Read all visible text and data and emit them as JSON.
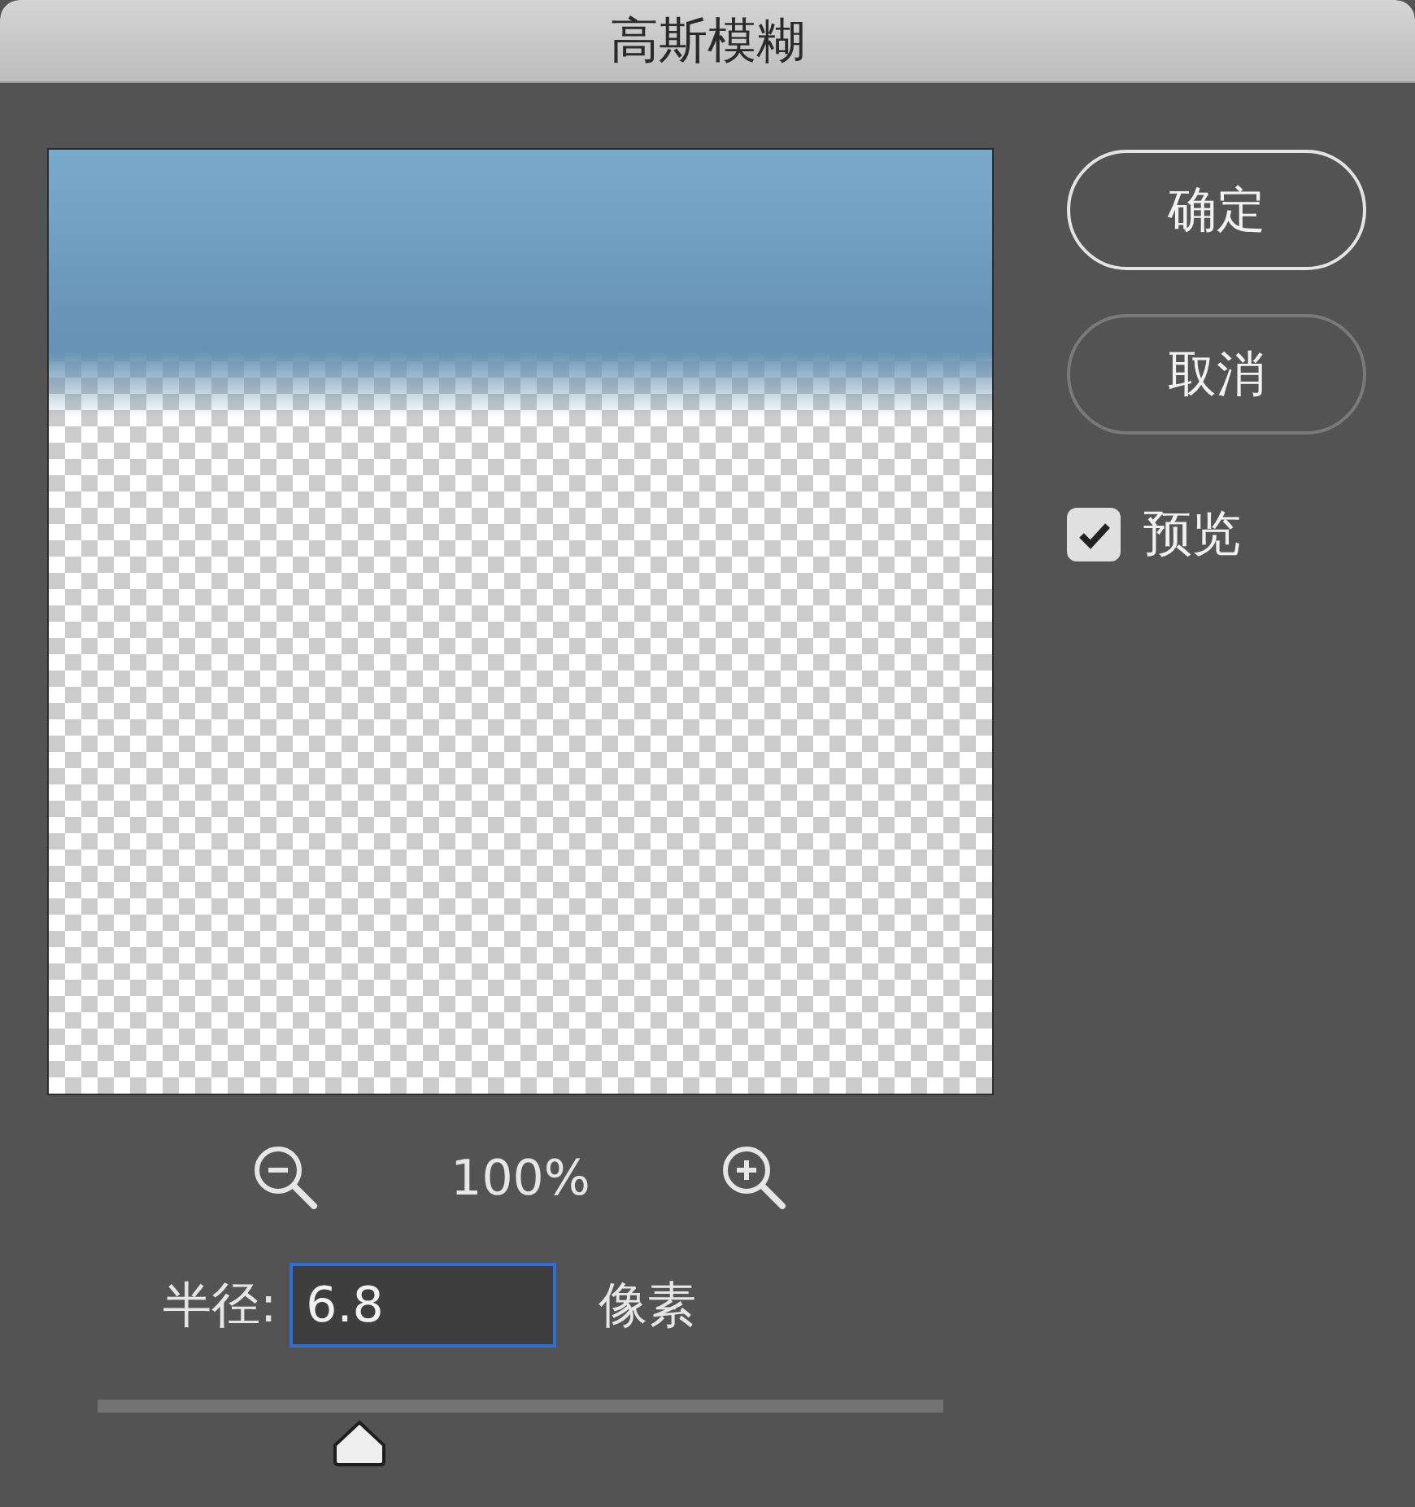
{
  "window": {
    "title": "高斯模糊"
  },
  "buttons": [
    {
      "label": "确定",
      "default": true
    },
    {
      "label": "取消",
      "default": false
    }
  ],
  "preview_checkbox": {
    "label": "预览",
    "checked": true
  },
  "zoom": {
    "value": "100%"
  },
  "radius": {
    "label": "半径:",
    "value": "6.8",
    "unit": "像素",
    "focused": true
  },
  "slider": {
    "level": 0.31
  }
}
